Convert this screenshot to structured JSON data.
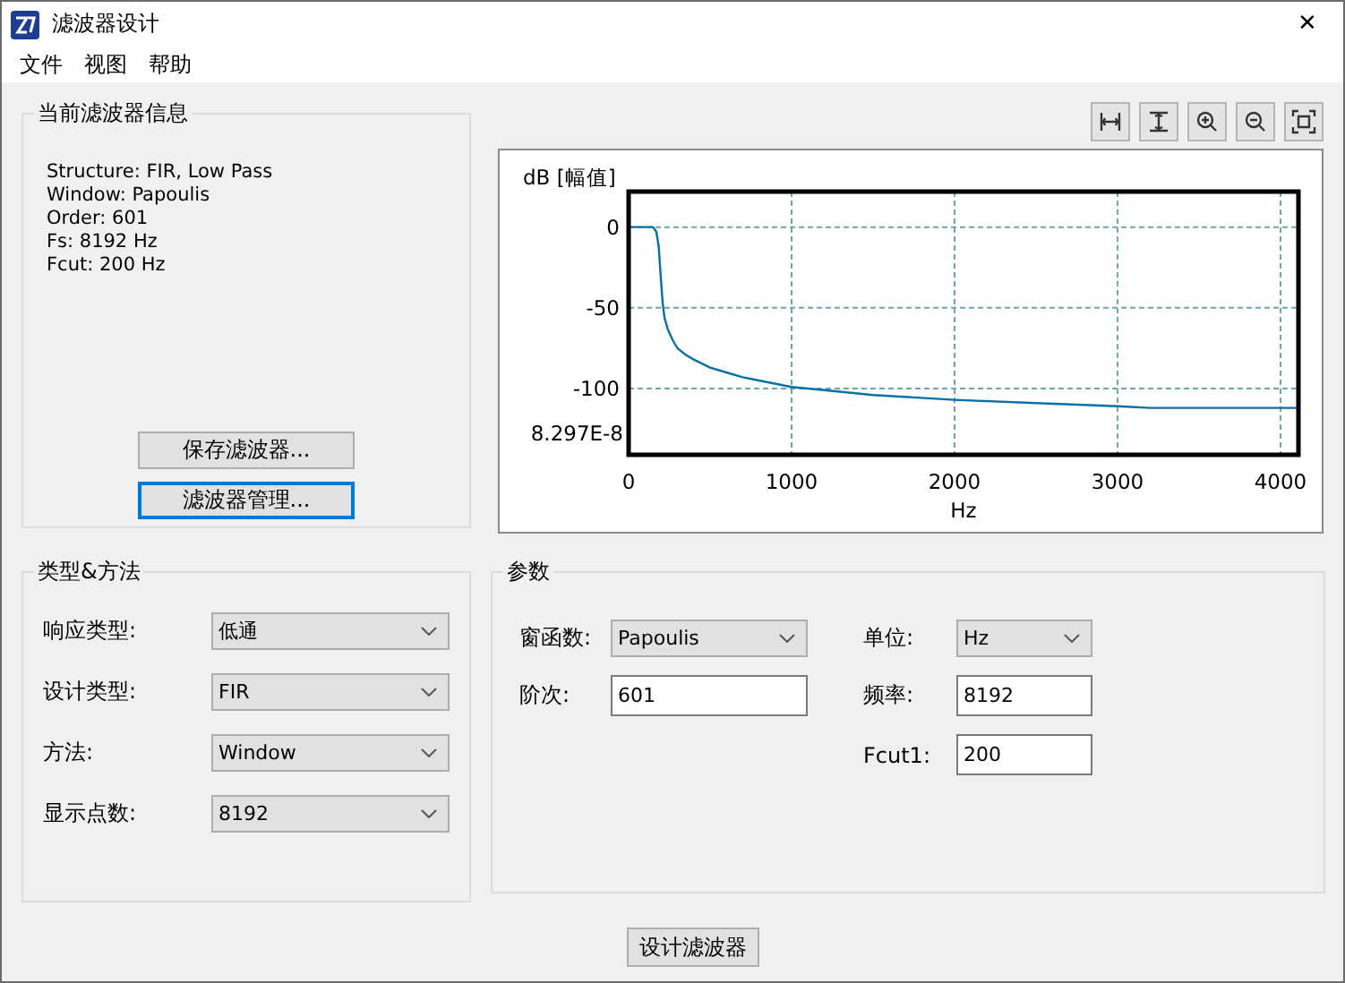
{
  "window": {
    "title": "滤波器设计",
    "close": "✕"
  },
  "menu": [
    "文件",
    "视图",
    "帮助"
  ],
  "filter_info": {
    "title": "当前滤波器信息",
    "lines": [
      "Structure: FIR, Low Pass",
      "Window: Papoulis",
      "Order: 601",
      "Fs: 8192 Hz",
      "Fcut: 200 Hz"
    ],
    "buttons": [
      {
        "label": "保存滤波器...",
        "focused": false
      },
      {
        "label": "滤波器管理...",
        "focused": true
      }
    ]
  },
  "chart_toolbar": [
    {
      "kind": "fit-x"
    },
    {
      "kind": "fit-y"
    },
    {
      "kind": "zoom-in"
    },
    {
      "kind": "zoom-out"
    },
    {
      "kind": "fit-all"
    }
  ],
  "chart_data": {
    "type": "line",
    "ylabel": "dB [幅值]",
    "xlabel": "Hz",
    "xlim": [
      0,
      4110
    ],
    "ylim": [
      -141,
      22
    ],
    "xticks": [
      0,
      1000,
      2000,
      3000,
      4000
    ],
    "yticks": [
      0,
      -50,
      -100
    ],
    "grid": true,
    "x": [
      0,
      150,
      170,
      185,
      200,
      210,
      220,
      240,
      270,
      300,
      350,
      400,
      500,
      600,
      700,
      800,
      1000,
      1200,
      1500,
      2000,
      2500,
      3000,
      3200,
      4110
    ],
    "series": [
      {
        "color": "#0a6fa8",
        "values": [
          0,
          0,
          -3,
          -12,
          -35,
          -48,
          -56,
          -63,
          -70,
          -75,
          -79,
          -82,
          -87,
          -90,
          -93,
          -95,
          -99,
          -101,
          -104,
          -107,
          -109,
          -111,
          -112,
          -112
        ]
      }
    ]
  },
  "plot_min_label": "8.297E-8",
  "type_method": {
    "title": "类型&方法",
    "rows": [
      {
        "label": "响应类型:",
        "value": "低通"
      },
      {
        "label": "设计类型:",
        "value": "FIR"
      },
      {
        "label": "方法:",
        "value": "Window"
      },
      {
        "label": "显示点数:",
        "value": "8192"
      }
    ]
  },
  "params": {
    "title": "参数",
    "columns": [
      {
        "fields": [
          {
            "label": "窗函数:",
            "value": "Papoulis",
            "kind": "dropdown"
          },
          {
            "label": "阶次:",
            "value": "601",
            "kind": "input"
          }
        ]
      },
      {
        "fields": [
          {
            "label": "单位:",
            "value": "Hz",
            "kind": "dropdown"
          },
          {
            "label": "频率:",
            "value": "8192",
            "kind": "input"
          },
          {
            "label": "Fcut1:",
            "value": "200",
            "kind": "input"
          }
        ]
      }
    ]
  },
  "design_button": "设计滤波器"
}
